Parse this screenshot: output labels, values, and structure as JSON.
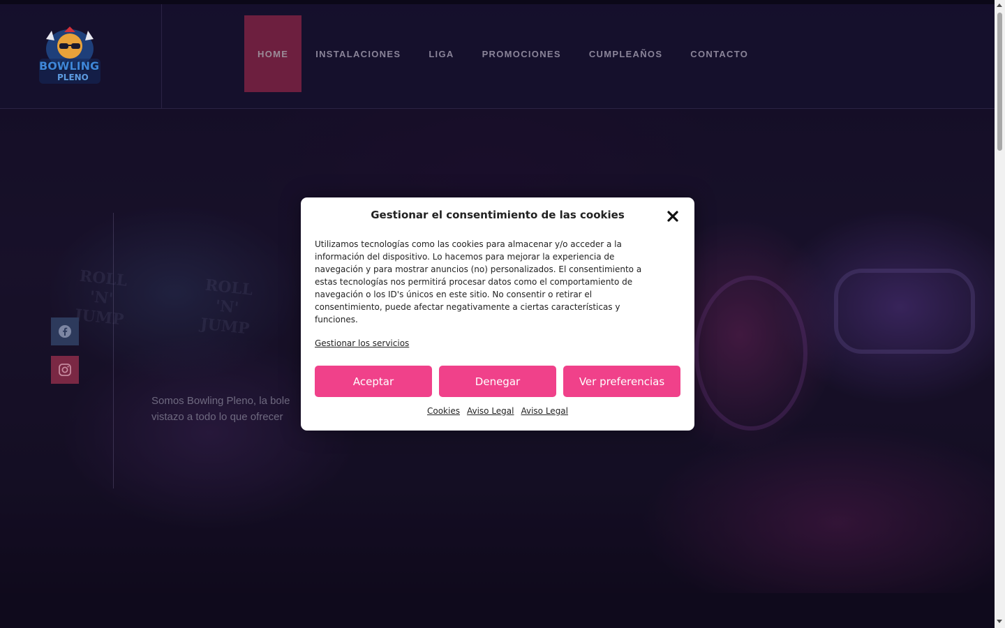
{
  "header": {
    "logo": {
      "line1": "BOWLING",
      "line2": "PLENO"
    },
    "nav": [
      {
        "label": "HOME",
        "active": true
      },
      {
        "label": "INSTALACIONES",
        "active": false
      },
      {
        "label": "LIGA",
        "active": false
      },
      {
        "label": "PROMOCIONES",
        "active": false
      },
      {
        "label": "CUMPLEAÑOS",
        "active": false
      },
      {
        "label": "CONTACTO",
        "active": false
      }
    ]
  },
  "social": [
    {
      "icon": "facebook-icon"
    },
    {
      "icon": "instagram-icon"
    }
  ],
  "hero": {
    "text": "Somos Bowling Pleno, la bole\nvistazo a todo lo que ofrecer"
  },
  "cookie_modal": {
    "title": "Gestionar el consentimiento de las cookies",
    "body": "Utilizamos tecnologías como las cookies para almacenar y/o acceder a la información del dispositivo. Lo hacemos para mejorar la experiencia de navegación y para mostrar anuncios (no) personalizados. El consentimiento a estas tecnologías nos permitirá procesar datos como el comportamiento de navegación o los ID's únicos en este sitio. No consentir o retirar el consentimiento, puede afectar negativamente a ciertas características y funciones.",
    "manage_link": "Gestionar los servicios",
    "buttons": {
      "accept": "Aceptar",
      "deny": "Denegar",
      "preferences": "Ver preferencias"
    },
    "links": [
      "Cookies",
      "Aviso Legal",
      "Aviso Legal"
    ]
  },
  "colors": {
    "accent": "#f0418a",
    "nav_active": "#6d1f3f",
    "header_bg": "#16102c"
  }
}
